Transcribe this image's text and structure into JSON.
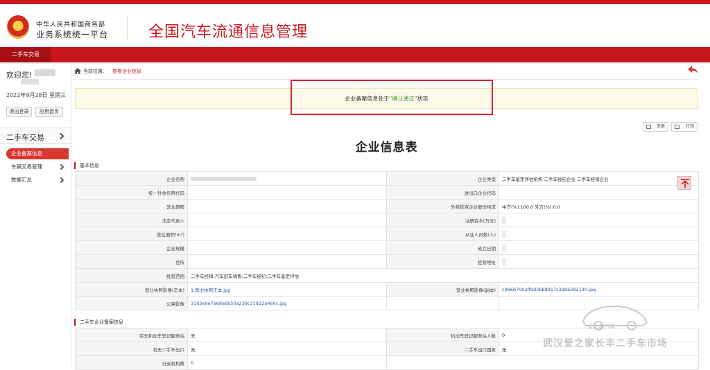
{
  "header": {
    "org_line1": "中华人民共和国商务部",
    "org_line2": "业务系统统一平台",
    "system_title": "全国汽车流通信息管理"
  },
  "navbar": {
    "active_tab": "二手车交易"
  },
  "sidebar": {
    "welcome": "欢迎您!",
    "date": "2022年9月28日 星期三",
    "logout_label": "退出登录",
    "home_label": "应用首页",
    "section_title": "二手车交易",
    "items": [
      {
        "label": "企业备案信息",
        "active": true
      },
      {
        "label": "车辆交易管理",
        "active": false
      },
      {
        "label": "数据汇总",
        "active": false
      }
    ]
  },
  "breadcrumb": {
    "prefix": "当前位置:",
    "current": "查看企业信息"
  },
  "notice": {
    "before": "企业备案信息处于",
    "highlight": "“确认通过”",
    "after": "状态",
    "highlight_color": "#3c9a2f"
  },
  "toolbar": {
    "change_label": "变更",
    "print_label": "打印"
  },
  "form": {
    "title": "企业信息表",
    "basic_section": "基本信息",
    "basic_rows": [
      {
        "l1": "企业名称",
        "v1": "",
        "l2": "企业类型",
        "v2": "二手车鉴定评估机构 二手车经纪企业 二手车经销企业"
      },
      {
        "l1": "统一社会信用代码",
        "v1": "",
        "l2": "进出口企业代码",
        "v2": ""
      },
      {
        "l1": "营业期限",
        "v1": "",
        "l2": "外商投资企业股份构成",
        "v2": "中方(%):100.0 外方(%):0.0"
      },
      {
        "l1": "法定代表人",
        "v1": "",
        "l2": "注册资本(万元)",
        "v2": ""
      },
      {
        "l1": "营业面积(m²)",
        "v1": "",
        "l2": "从业人员数(人)",
        "v2": ""
      },
      {
        "l1": "企业规模",
        "v1": "",
        "l2": "成立日期",
        "v2": ""
      },
      {
        "l1": "住所",
        "v1": "",
        "l2": "经营地址",
        "v2": ""
      }
    ],
    "scope_label": "经营范围",
    "scope_value": "二手车经销;汽车旧车销售;二手车经纪;二手车鉴定评估",
    "license_main_label": "营业执照影像(正本)",
    "license_main_value": "1.营业执照正本.jpg",
    "license_copy_label": "营业执照影像(副本)",
    "license_copy_value": "c986b790affbd36b8917c3db6282130.jpg",
    "seal_label": "公章影像",
    "seal_value": "31d3e9e7a69a6b50a239c31922a460c.jpg",
    "used_section": "二手车企业备案信息",
    "used_rows": [
      {
        "l1": "有无机动车登记服务站",
        "v1": "无",
        "l2": "机动车登记服务站人数",
        "v2": "0"
      },
      {
        "l1": "有无二手车出口",
        "v1": "无",
        "l2": "二手车出口国家",
        "v2": "无"
      },
      {
        "l1": "分支机构数",
        "v1": "0"
      }
    ]
  },
  "watermark": {
    "text": "武汉爱之家长丰二手车市场",
    "brand": "爱之家汽车"
  }
}
